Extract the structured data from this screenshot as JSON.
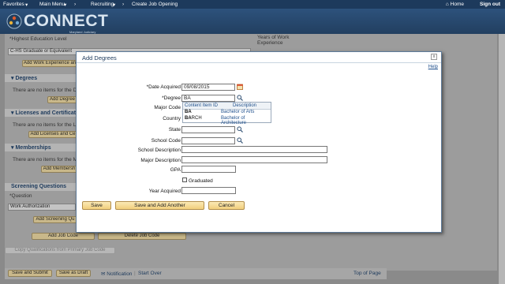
{
  "topnav": {
    "favorites": "Favorites",
    "main_menu": "Main Menu",
    "recruiting": "Recruiting",
    "create_job_opening": "Create Job Opening",
    "home": "Home",
    "signout": "Sign out"
  },
  "header": {
    "logo_text": "CONNECT",
    "logo_sub": "Maryland Judiciary"
  },
  "background": {
    "highest_education_label": "*Highest Education Level",
    "years_of_work_label": "Years of Work Experience",
    "education_value": "C-HS Graduate or Equivalent",
    "add_work_experience": "Add Work Experience an",
    "degrees_header": "Degrees",
    "degrees_empty": "There are no items for the De",
    "add_degree": "Add Degree",
    "licenses_header": "Licenses and Certificat",
    "licenses_empty": "There are no items for the Lic",
    "add_licenses": "Add Licenses and Ce",
    "memberships_header": "Memberships",
    "memberships_empty": "There are no items for the Me",
    "add_membership": "Add Membersh",
    "screening_header": "Screening Questions",
    "question_label": "*Question",
    "question_value": "Work Authorization",
    "add_screening": "Add Screening Qu",
    "add_job_code": "Add Job Code",
    "delete_job_code": "Delete Job Code",
    "copy_qualifications": "Copy Qualifications from Primary Job Code",
    "save_submit": "Save and Submit",
    "save_draft": "Save as Draft",
    "notification": "Notification",
    "start_over": "Start Over",
    "top_of_page": "Top of Page"
  },
  "modal": {
    "title": "Add Degrees",
    "help": "Help",
    "close": "x",
    "date_acquired_label": "*Date Acquired",
    "date_acquired_value": "09/08/2015",
    "degree_label": "*Degree",
    "degree_value": "BA",
    "major_code_label": "Major Code",
    "country_label": "Country",
    "state_label": "State",
    "school_code_label": "School Code",
    "school_description_label": "School Description",
    "major_description_label": "Major Description",
    "gpa_label": "GPA",
    "graduated_label": "Graduated",
    "year_acquired_label": "Year Acquired",
    "save": "Save",
    "save_add_another": "Save and Add Another",
    "cancel": "Cancel"
  },
  "dropdown": {
    "col_code": "Content Item ID",
    "col_desc": "Description",
    "rows": [
      {
        "code_bold": "BA",
        "code_rest": "",
        "desc": "Bachelor of Arts"
      },
      {
        "code_bold": "BA",
        "code_rest": "RCH",
        "desc": "Bachelor of Architecture"
      }
    ]
  },
  "colors": {
    "nav": "#1d3a5c",
    "accent": "#1e4f8c",
    "button": "#f1cf7c"
  }
}
